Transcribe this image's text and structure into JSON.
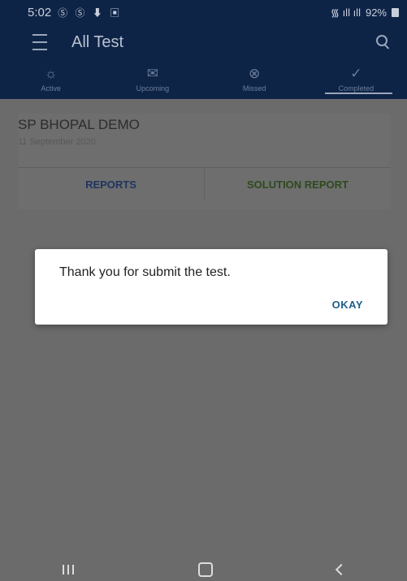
{
  "status_bar": {
    "time": "5:02",
    "left_icons": "Ⓢ Ⓢ ⬇ ▣",
    "right_signal": "📶",
    "battery": "92%"
  },
  "app_bar": {
    "title": "All Test"
  },
  "tabs": [
    {
      "label": "Active",
      "icon": "☼"
    },
    {
      "label": "Upcoming",
      "icon": "✉"
    },
    {
      "label": "Missed",
      "icon": "⊗"
    },
    {
      "label": "Completed",
      "icon": "✓"
    }
  ],
  "card": {
    "title": "SP BHOPAL DEMO",
    "date": "11 September 2020",
    "reports_label": "REPORTS",
    "solution_label": "SOLUTION REPORT"
  },
  "dialog": {
    "message": "Thank you for submit the test.",
    "ok_label": "OKAY"
  },
  "colors": {
    "app_bar_bg": "#0e2447",
    "scrim": "#6b6b6b",
    "dialog_accent": "#1f5f8b"
  }
}
